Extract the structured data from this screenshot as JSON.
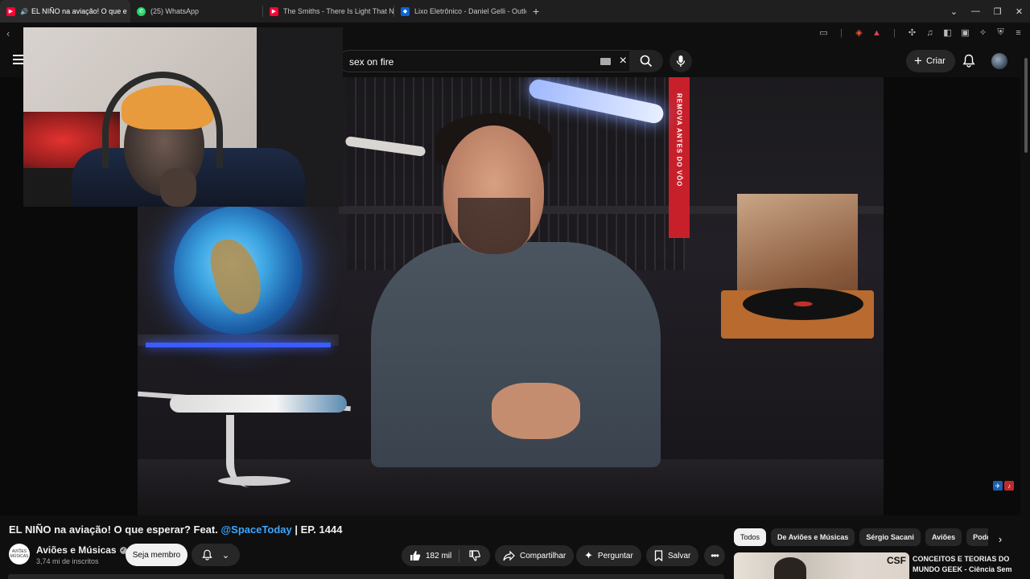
{
  "browser": {
    "tabs": [
      {
        "title": "EL NIÑO na aviação! O que e",
        "active": true,
        "icon": "youtube-icon",
        "audio": true
      },
      {
        "title": "(25) WhatsApp",
        "active": false,
        "icon": "whatsapp-icon"
      },
      {
        "title": "The Smiths - There Is Light That Nev",
        "active": false,
        "icon": "youtube-icon"
      },
      {
        "title": "Lixo Eletrônico - Daniel Gelli - Outloo",
        "active": false,
        "icon": "outlook-icon"
      }
    ],
    "new_tab_label": "+",
    "window_controls": [
      "minimize-icon",
      "maximize-icon",
      "close-icon"
    ]
  },
  "header": {
    "search_query": "sex on fire",
    "create_label": "Criar"
  },
  "player": {
    "banner_text": "REMOVA ANTES DO VÔO"
  },
  "video": {
    "title_prefix": "EL NIÑO na aviação! O que esperar? Feat. ",
    "title_mention": "@SpaceToday",
    "title_suffix": " | EP. 1444"
  },
  "channel": {
    "name": "Aviões e Músicas",
    "subscribers": "3,74 mi de inscritos",
    "avatar_text": "AVIÕES MÚSICAS",
    "join_label": "Seja membro"
  },
  "actions": {
    "likes": "182 mil",
    "share_label": "Compartilhar",
    "ask_label": "Perguntar",
    "save_label": "Salvar"
  },
  "chips": [
    "Todos",
    "De Aviões e Músicas",
    "Sérgio Sacani",
    "Aviões",
    "Podcasts"
  ],
  "recommendation": {
    "title_line1": "CONCEITOS E TEORIAS DO",
    "title_line2": "MUNDO GEEK - Ciência Sem",
    "thumb_mark": "CSF"
  },
  "colors": {
    "background": "#0f0f0f",
    "mention": "#3ea6ff",
    "youtube_red": "#ff0033",
    "whatsapp_green": "#25d366",
    "outlook_blue": "#0a64d8"
  }
}
